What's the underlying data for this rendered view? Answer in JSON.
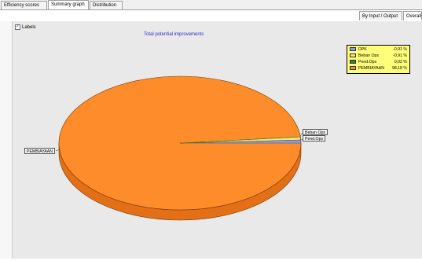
{
  "tabs": [
    {
      "label": "Efficiency scores",
      "active": false
    },
    {
      "label": "Summary graph",
      "active": true
    },
    {
      "label": "Distribution",
      "active": false
    }
  ],
  "view_tabs": [
    {
      "label": "By Input / Output",
      "active": false
    },
    {
      "label": "Overall",
      "active": true
    }
  ],
  "labels_checkbox": {
    "label": "Labels",
    "checked": true
  },
  "colors": {
    "orange": "#ff8c2a",
    "blue": "#7aa0ff",
    "yellow": "#ffe26a",
    "green": "#1f8f1f",
    "legend_bg": "#ffff7a",
    "title": "#2b2bd0"
  },
  "chart_data": {
    "type": "pie",
    "title": "Total potential improvements",
    "slices": [
      {
        "name": "DPK",
        "value_label": "-0,91 %",
        "percent": 0.91,
        "color": "#7aa0ff"
      },
      {
        "name": "Beban Ops",
        "value_label": "-0,91 %",
        "percent": 0.91,
        "color": "#ffe26a"
      },
      {
        "name": "Pend.Ops",
        "value_label": "0,02 %",
        "percent": 0.02,
        "color": "#1f8f1f"
      },
      {
        "name": "PEMBIAYAAN",
        "value_label": "98,18 %",
        "percent": 98.18,
        "color": "#ff8c2a"
      }
    ],
    "slice_labels": [
      "Beban Ops",
      "Pend.Ops",
      "PEMBIAYAAN"
    ],
    "legend_position": "top-right"
  }
}
